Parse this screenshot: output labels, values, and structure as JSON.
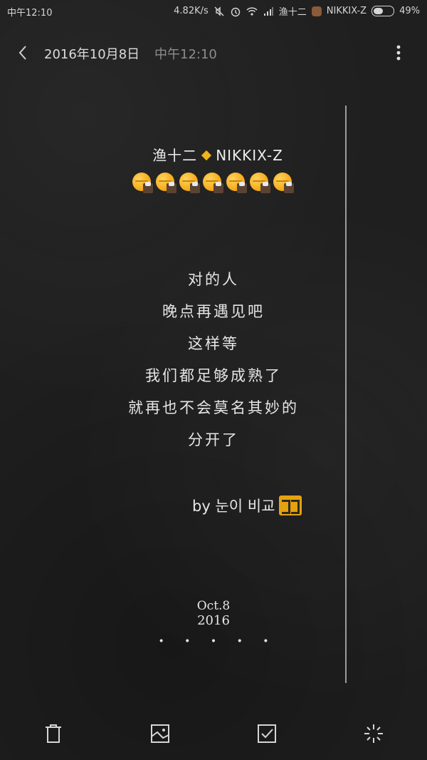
{
  "status_bar": {
    "time": "中午12:10",
    "network_speed": "4.82K/s",
    "carrier": "渔十二",
    "account_name": "NIKKIX-Z",
    "battery_percent": "49%",
    "battery_level": 0.49,
    "icons": [
      "mute-icon",
      "alarm-icon",
      "wifi-icon",
      "signal-icon",
      "bear-icon",
      "battery-icon"
    ]
  },
  "header": {
    "date": "2016年10月8日",
    "time": "中午12:10"
  },
  "note": {
    "title_left": "渔十二",
    "title_right": "NIKKIX-Z",
    "emoji_count": 7,
    "lines": [
      "对的人",
      "晚点再遇见吧",
      "这样等",
      "我们都足够成熟了",
      "就再也不会莫名其妙的",
      "分开了"
    ],
    "signature": "by 눈이 비교",
    "date_md": "Oct.8",
    "date_year": "2016",
    "dots": "• • • • •"
  },
  "toolbar": {
    "items": [
      "trash-icon",
      "image-icon",
      "checkbox-icon",
      "sparkle-icon"
    ]
  },
  "colors": {
    "accent": "#f0b21b",
    "background": "#1f1f1f",
    "text": "#e6e6e6"
  }
}
